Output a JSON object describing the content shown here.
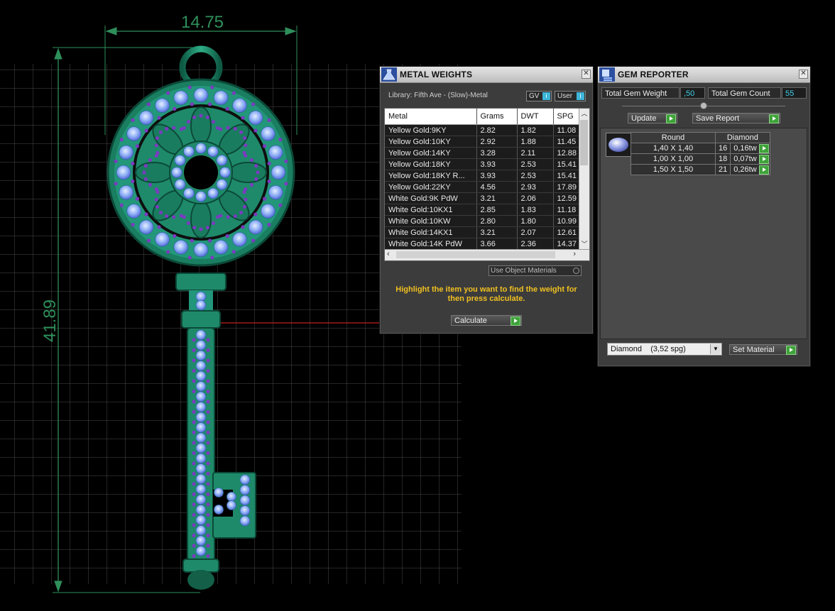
{
  "viewport": {
    "dimension_width": "14.75",
    "dimension_height": "41.89"
  },
  "metal_weights": {
    "title": "METAL WEIGHTS",
    "library": "Library: Fifth Ave - (Slow)-Metal",
    "gv_label": "GV",
    "user_label": "User",
    "columns": [
      "Metal",
      "Grams",
      "DWT",
      "SPG"
    ],
    "rows": [
      [
        "Yellow Gold:9KY",
        "2.82",
        "1.82",
        "11.08"
      ],
      [
        "Yellow Gold:10KY",
        "2.92",
        "1.88",
        "11.45"
      ],
      [
        "Yellow Gold:14KY",
        "3.28",
        "2.11",
        "12.88"
      ],
      [
        "Yellow Gold:18KY",
        "3.93",
        "2.53",
        "15.41"
      ],
      [
        "Yellow Gold:18KY R...",
        "3.93",
        "2.53",
        "15.41"
      ],
      [
        "Yellow Gold:22KY",
        "4.56",
        "2.93",
        "17.89"
      ],
      [
        "White Gold:9K PdW",
        "3.21",
        "2.06",
        "12.59"
      ],
      [
        "White Gold:10KX1",
        "2.85",
        "1.83",
        "11.18"
      ],
      [
        "White Gold:10KW",
        "2.80",
        "1.80",
        "10.99"
      ],
      [
        "White Gold:14KX1",
        "3.21",
        "2.07",
        "12.61"
      ],
      [
        "White Gold:14K PdW",
        "3.66",
        "2.36",
        "14.37"
      ]
    ],
    "use_object_materials": "Use Object Materials",
    "instruction": "Highlight the item you want to find the weight for then press calculate.",
    "calculate": "Calculate"
  },
  "gem_reporter": {
    "title": "GEM REPORTER",
    "total_weight_label": "Total Gem Weight",
    "total_weight_value": ",50",
    "total_count_label": "Total Gem Count",
    "total_count_value": "55",
    "update": "Update",
    "save_report": "Save Report",
    "headers": [
      "Round",
      "Diamond"
    ],
    "rows": [
      [
        "1,40 X 1,40",
        "16",
        "0,16tw"
      ],
      [
        "1,00 X 1,00",
        "18",
        "0,07tw"
      ],
      [
        "1,50 X 1,50",
        "21",
        "0,26tw"
      ]
    ],
    "material_select": "Diamond    (3,52 spg)",
    "set_material": "Set Material"
  },
  "colors": {
    "grid": "#4d4d4d",
    "metal_green": "#1f8a6a",
    "gem_blue": "#8fb0f5",
    "accent_purple": "#7a3bc0",
    "dimension_green": "#2e8f5a",
    "instruction_yellow": "#f0c020",
    "value_cyan": "#3fd0e8"
  }
}
